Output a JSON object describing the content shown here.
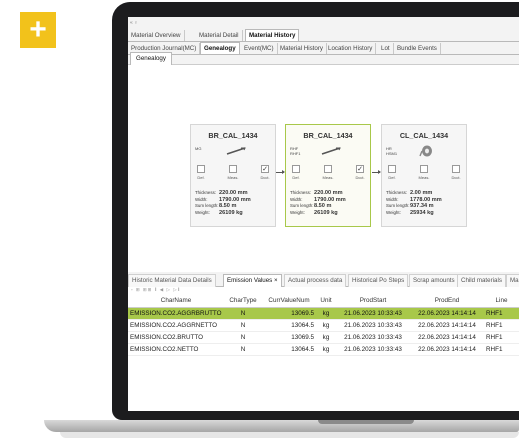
{
  "window": {
    "title_stub": "« ♀"
  },
  "tabs_main": [
    "Material Overview",
    "Material Detail",
    "Material History"
  ],
  "tabs_main_active": "Material History",
  "tabs_sub": [
    "Production Journal(MC)",
    "Genealogy",
    "Event(MC)",
    "Material History",
    "Location History",
    "Lot",
    "Bundle Events"
  ],
  "tabs_sub_active": "Genealogy",
  "genealogy_tab": "Genealogy",
  "cards": [
    {
      "title": "BR_CAL_1434",
      "sub": [
        "MG"
      ],
      "icon": "coil-strip-icon",
      "checks": [
        {
          "label": "Def.",
          "checked": false
        },
        {
          "label": "Meas.",
          "checked": false
        },
        {
          "label": "Dcct.",
          "checked": true
        }
      ],
      "props": [
        [
          "Thickness:",
          "220.00 mm"
        ],
        [
          "Width:",
          "1790.00 mm"
        ],
        [
          "Sum length:",
          "8.50 m"
        ],
        [
          "Weight:",
          "26109 kg"
        ]
      ]
    },
    {
      "title": "BR_CAL_1434",
      "sub": [
        "RHF",
        "RHF1"
      ],
      "icon": "coil-strip-icon",
      "checks": [
        {
          "label": "Def.",
          "checked": false
        },
        {
          "label": "Meas.",
          "checked": false
        },
        {
          "label": "Dcct.",
          "checked": true
        }
      ],
      "props": [
        [
          "Thickness:",
          "220.00 mm"
        ],
        [
          "Width:",
          "1790.00 mm"
        ],
        [
          "Sum length:",
          "8.50 m"
        ],
        [
          "Weight:",
          "26109 kg"
        ]
      ]
    },
    {
      "title": "CL_CAL_1434",
      "sub": [
        "HR",
        "HSM1"
      ],
      "icon": "coil-icon",
      "checks": [
        {
          "label": "Def.",
          "checked": false
        },
        {
          "label": "Meas.",
          "checked": false
        },
        {
          "label": "Dcct.",
          "checked": false
        }
      ],
      "props": [
        [
          "Thickness:",
          "2.00 mm"
        ],
        [
          "Width:",
          "1778.00 mm"
        ],
        [
          "Sum length:",
          "937.34 m"
        ],
        [
          "Weight:",
          "25934 kg"
        ]
      ]
    }
  ],
  "bottom_tabs": [
    "Historic Material Data Details",
    "Emission Values ×",
    "Actual process data",
    "Historical Po Steps",
    "Scrap amounts",
    "Child materials",
    "Ma"
  ],
  "bottom_tabs_active": "Emission Values ×",
  "toolbar_strip": "▫ ⊞ ⊞⊞ ‖ ◀ ▷ ▷‖",
  "table": {
    "columns": [
      "CharName",
      "CharType",
      "CurrValueNum",
      "Unit",
      "ProdStart",
      "ProdEnd",
      "Line"
    ],
    "rows": [
      [
        "EMISSION.CO2.AGGRBRUTTO",
        "N",
        "13069.5",
        "kg",
        "21.06.2023 10:33:43",
        "22.06.2023 14:14:14",
        "RHF1"
      ],
      [
        "EMISSION.CO2.AGGRNETTO",
        "N",
        "13064.5",
        "kg",
        "21.06.2023 10:33:43",
        "22.06.2023 14:14:14",
        "RHF1"
      ],
      [
        "EMISSION.CO2.BRUTTO",
        "N",
        "13069.5",
        "kg",
        "21.06.2023 10:33:43",
        "22.06.2023 14:14:14",
        "RHF1"
      ],
      [
        "EMISSION.CO2.NETTO",
        "N",
        "13064.5",
        "kg",
        "21.06.2023 10:33:43",
        "22.06.2023 14:14:14",
        "RHF1"
      ]
    ],
    "selected_row": 0
  },
  "colors": {
    "accent_green": "#a8c84a",
    "badge_yellow": "#f2c21b"
  },
  "badge_icon": "plus-icon"
}
